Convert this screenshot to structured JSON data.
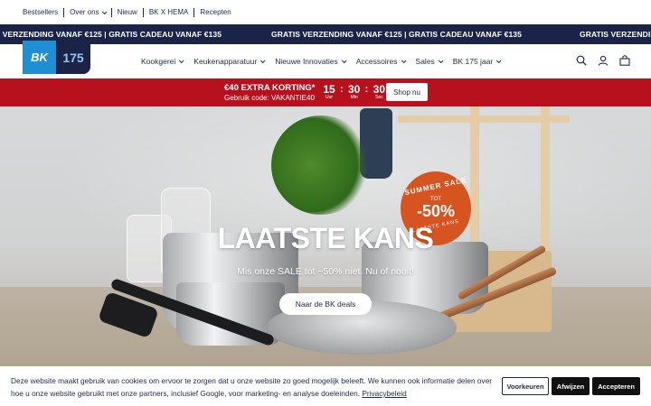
{
  "utility_nav": [
    {
      "label": "Bestsellers",
      "dropdown": false
    },
    {
      "label": "Over ons",
      "dropdown": true
    },
    {
      "label": "Nieuw",
      "dropdown": false
    },
    {
      "label": "BK X HEMA",
      "dropdown": false
    },
    {
      "label": "Recepten",
      "dropdown": false
    }
  ],
  "marquee": {
    "text_left": "IS VERZENDING VANAF €125 | GRATIS CADEAU VANAF €135",
    "text_center": "GRATIS VERZENDING VANAF €125 | GRATIS CADEAU VANAF €135",
    "text_right": "GRATIS VERZENDING"
  },
  "logo": {
    "brand": "BK",
    "anniversary": "175"
  },
  "main_nav": [
    {
      "label": "Kookgerei"
    },
    {
      "label": "Keukenapparatuur"
    },
    {
      "label": "Nieuwe Innovaties"
    },
    {
      "label": "Accessoires"
    },
    {
      "label": "Sales"
    },
    {
      "label": "BK 175 jaar"
    }
  ],
  "header_icons": [
    "search-icon",
    "account-icon",
    "cart-icon"
  ],
  "promo": {
    "title": "€40 EXTRA KORTING*",
    "code": "Gebruik code: VAKANTIE40",
    "countdown": {
      "hours": "15",
      "hours_label": "Uur",
      "minutes": "30",
      "minutes_label": "Min",
      "seconds": "30",
      "seconds_label": "Sec"
    },
    "button": "Shop nu",
    "color": "#b7111e"
  },
  "hero": {
    "title": "LAATSTE KANS",
    "subtitle": "Mis onze SALE tot ~50% niet. Nu of nooit!",
    "button": "Naar de BK deals",
    "badge": {
      "top": "SUMMER SALE",
      "tot": "TOT",
      "percent": "-50%",
      "bottom": "LAATSTE KANS",
      "color": "#d5541f"
    }
  },
  "cookie": {
    "text": "Deze website maakt gebruik van cookies om ervoor te zorgen dat u onze website zo goed mogelijk beleeft. We kunnen ook informatie delen over hoe u onze website gebruikt met onze partners, inclusief Google, voor marketing- en analyse doeleinden.",
    "link": "Privacybeleid",
    "preferences": "Voorkeuren",
    "reject": "Afwijzen",
    "accept": "Accepteren"
  },
  "colors": {
    "navy": "#1b2448",
    "accent_blue": "#1f8fd3"
  }
}
